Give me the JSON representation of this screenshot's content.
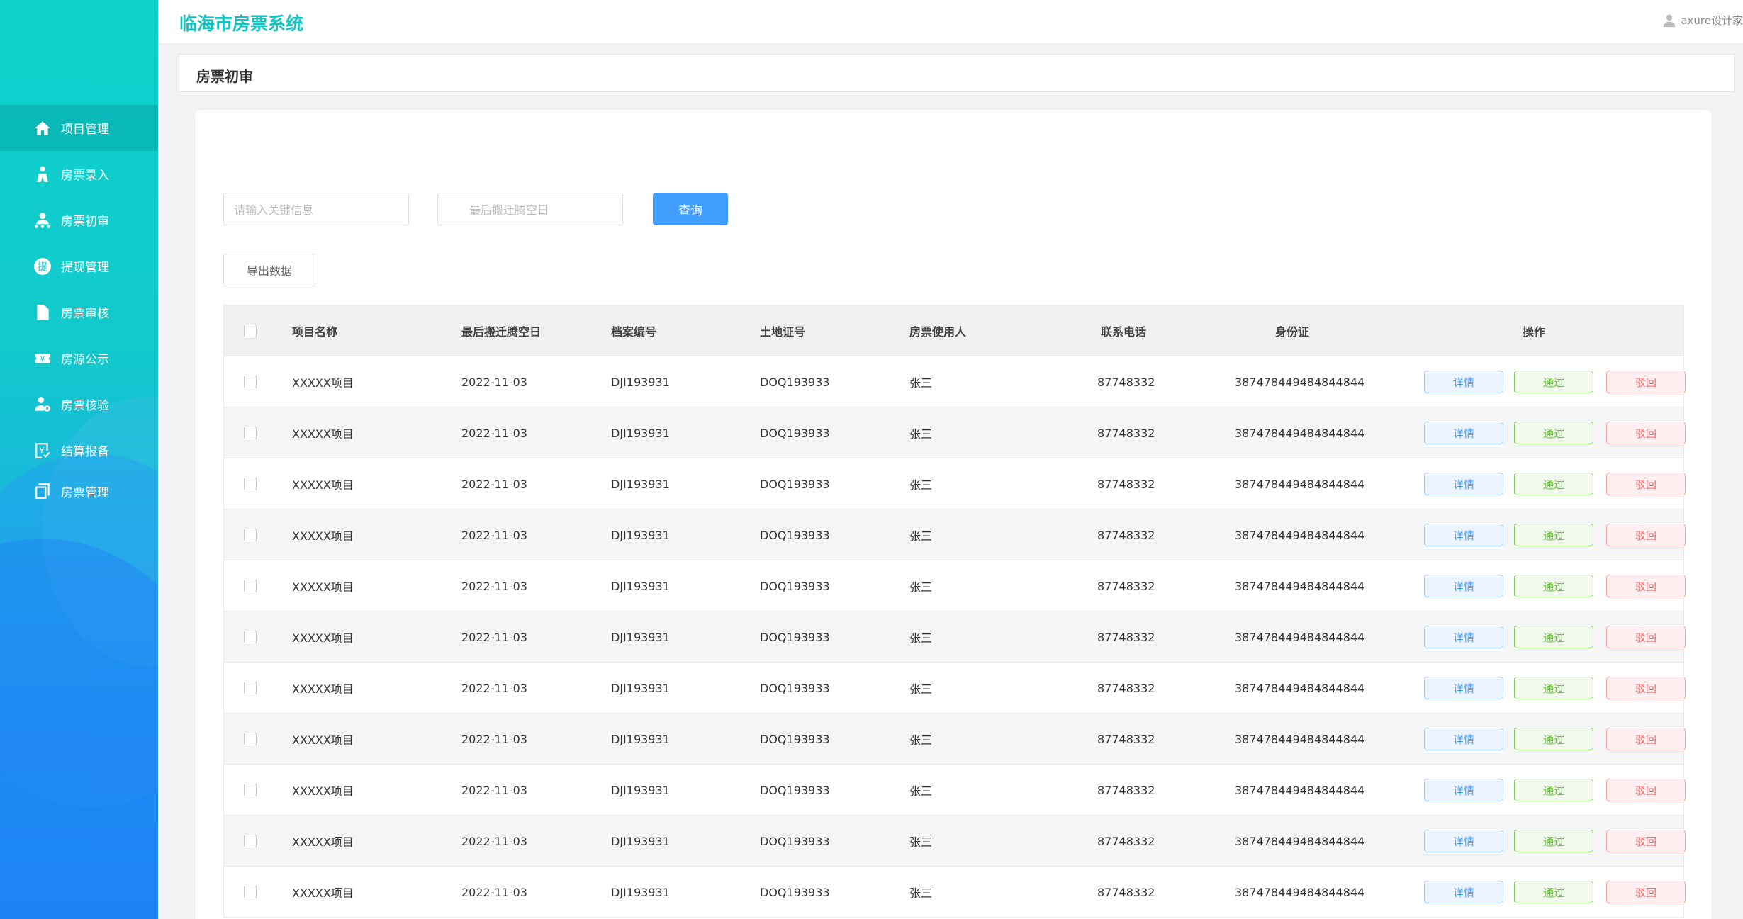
{
  "app": {
    "title": "临海市房票系统",
    "user_name": "axure设计家"
  },
  "sidebar": {
    "items": [
      {
        "label": "项目管理",
        "icon": "home-icon",
        "active": true
      },
      {
        "label": "房票录入",
        "icon": "person-tie-icon",
        "active": false
      },
      {
        "label": "房票初审",
        "icon": "person-group-icon",
        "active": false
      },
      {
        "label": "提现管理",
        "icon": "withdraw-icon",
        "active": false
      },
      {
        "label": "房票审核",
        "icon": "document-icon",
        "active": false
      },
      {
        "label": "房源公示",
        "icon": "yen-ticket-icon",
        "active": false
      },
      {
        "label": "房票核验",
        "icon": "user-gear-icon",
        "active": false
      },
      {
        "label": "结算报备",
        "icon": "yen-check-icon",
        "active": false
      },
      {
        "label": "房票管理",
        "icon": "copy-icon",
        "active": false
      }
    ]
  },
  "page": {
    "title": "房票初审"
  },
  "search": {
    "keyword_placeholder": "请输入关键信息",
    "date_placeholder": "最后搬迁腾空日",
    "query_label": "查询",
    "export_label": "导出数据"
  },
  "table": {
    "columns": [
      "项目名称",
      "最后搬迁腾空日",
      "档案编号",
      "土地证号",
      "房票使用人",
      "联系电话",
      "身份证",
      "操作"
    ],
    "actions": {
      "detail": "详情",
      "pass": "通过",
      "reject": "驳回"
    },
    "rows": [
      {
        "project": "XXXXX项目",
        "date": "2022-11-03",
        "archive": "DJI193931",
        "land": "DOQ193933",
        "user": "张三",
        "phone": "87748332",
        "id": "387478449484844844"
      },
      {
        "project": "XXXXX项目",
        "date": "2022-11-03",
        "archive": "DJI193931",
        "land": "DOQ193933",
        "user": "张三",
        "phone": "87748332",
        "id": "387478449484844844"
      },
      {
        "project": "XXXXX项目",
        "date": "2022-11-03",
        "archive": "DJI193931",
        "land": "DOQ193933",
        "user": "张三",
        "phone": "87748332",
        "id": "387478449484844844"
      },
      {
        "project": "XXXXX项目",
        "date": "2022-11-03",
        "archive": "DJI193931",
        "land": "DOQ193933",
        "user": "张三",
        "phone": "87748332",
        "id": "387478449484844844"
      },
      {
        "project": "XXXXX项目",
        "date": "2022-11-03",
        "archive": "DJI193931",
        "land": "DOQ193933",
        "user": "张三",
        "phone": "87748332",
        "id": "387478449484844844"
      },
      {
        "project": "XXXXX项目",
        "date": "2022-11-03",
        "archive": "DJI193931",
        "land": "DOQ193933",
        "user": "张三",
        "phone": "87748332",
        "id": "387478449484844844"
      },
      {
        "project": "XXXXX项目",
        "date": "2022-11-03",
        "archive": "DJI193931",
        "land": "DOQ193933",
        "user": "张三",
        "phone": "87748332",
        "id": "387478449484844844"
      },
      {
        "project": "XXXXX项目",
        "date": "2022-11-03",
        "archive": "DJI193931",
        "land": "DOQ193933",
        "user": "张三",
        "phone": "87748332",
        "id": "387478449484844844"
      },
      {
        "project": "XXXXX项目",
        "date": "2022-11-03",
        "archive": "DJI193931",
        "land": "DOQ193933",
        "user": "张三",
        "phone": "87748332",
        "id": "387478449484844844"
      },
      {
        "project": "XXXXX项目",
        "date": "2022-11-03",
        "archive": "DJI193931",
        "land": "DOQ193933",
        "user": "张三",
        "phone": "87748332",
        "id": "387478449484844844"
      },
      {
        "project": "XXXXX项目",
        "date": "2022-11-03",
        "archive": "DJI193931",
        "land": "DOQ193933",
        "user": "张三",
        "phone": "87748332",
        "id": "387478449484844844"
      }
    ]
  }
}
